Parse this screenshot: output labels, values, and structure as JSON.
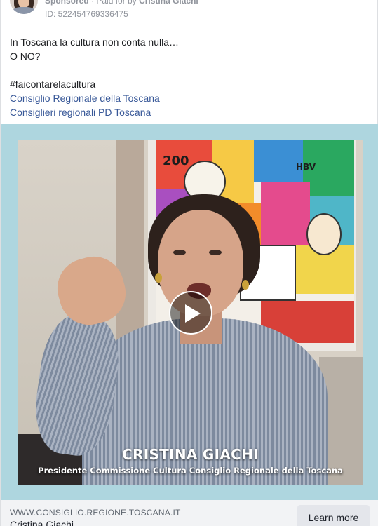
{
  "header": {
    "sponsored_label": "Sponsored",
    "paid_for_prefix": "· Paid for by",
    "payer": "Cristina Giachi",
    "ad_id": "ID: 522454769336475",
    "more_label": "···"
  },
  "post": {
    "line1": "In Toscana la cultura non conta nulla…",
    "line2": "O NO?",
    "hashtag": "#faicontarelacultura",
    "link1": "Consiglio Regionale della Toscana",
    "link2": "Consiglieri regionali PD Toscana"
  },
  "video": {
    "caption_name": "CRISTINA GIACHI",
    "caption_subtitle": "Presidente Commissione Cultura Consiglio Regionale della Toscana",
    "painting_text_1": "200",
    "painting_text_2": "HBV"
  },
  "footer": {
    "domain": "WWW.CONSIGLIO.REGIONE.TOSCANA.IT",
    "title": "Cristina Giachi",
    "cta_label": "Learn more"
  },
  "colors": {
    "link": "#385898",
    "video_border": "#aed6df",
    "footer_bg": "#f2f3f5"
  }
}
